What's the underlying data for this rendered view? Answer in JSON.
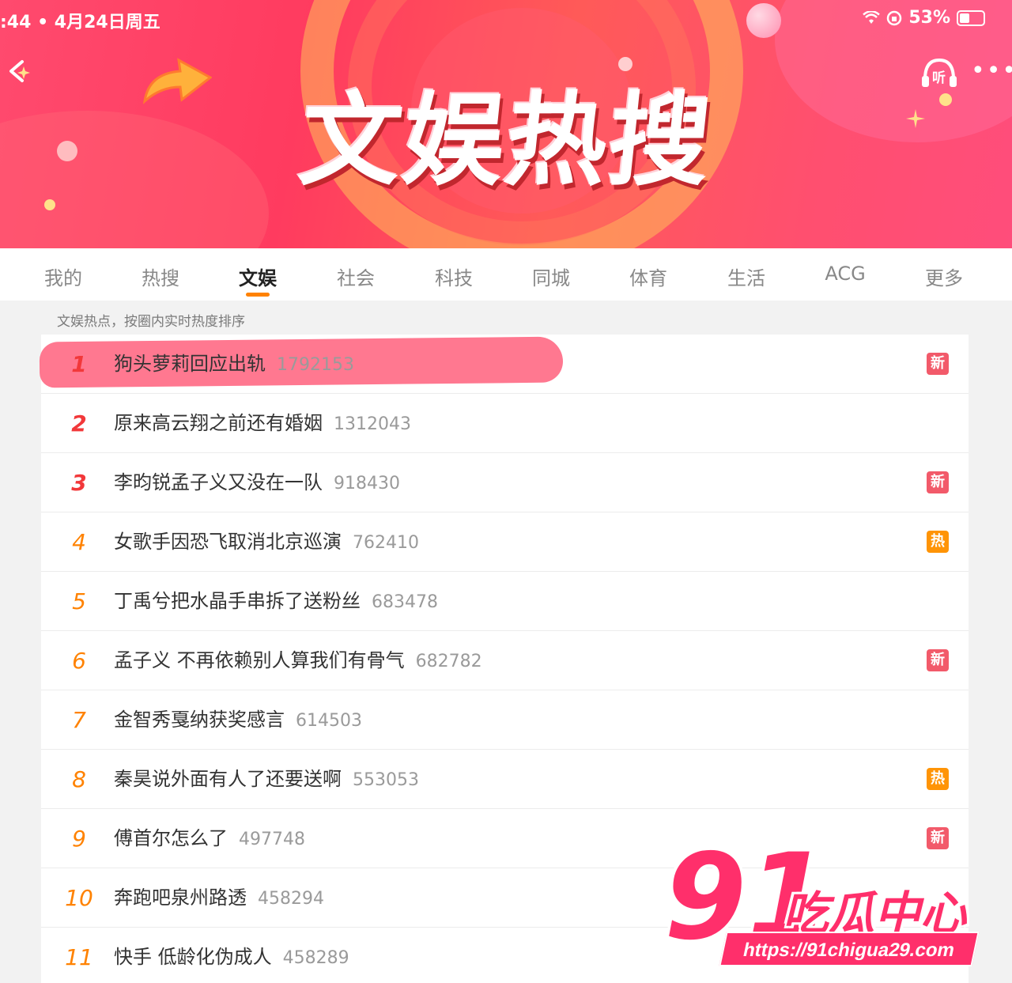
{
  "status_bar": {
    "time_date": ":44 • 4月24日周五",
    "battery": "53%"
  },
  "header": {
    "title": "文娱热搜",
    "listen_label": "听",
    "more_label": "•••"
  },
  "tabs": [
    {
      "label": "我的",
      "active": false
    },
    {
      "label": "热搜",
      "active": false
    },
    {
      "label": "文娱",
      "active": true
    },
    {
      "label": "社会",
      "active": false
    },
    {
      "label": "科技",
      "active": false
    },
    {
      "label": "同城",
      "active": false
    },
    {
      "label": "体育",
      "active": false
    },
    {
      "label": "生活",
      "active": false
    },
    {
      "label": "ACG",
      "active": false
    },
    {
      "label": "更多",
      "active": false
    }
  ],
  "subtitle": "文娱热点，按圈内实时热度排序",
  "list": [
    {
      "rank": "1",
      "title": "狗头萝莉回应出轨",
      "count": "1792153",
      "badge": "新",
      "badge_type": "new"
    },
    {
      "rank": "2",
      "title": "原来高云翔之前还有婚姻",
      "count": "1312043",
      "badge": "",
      "badge_type": ""
    },
    {
      "rank": "3",
      "title": "李昀锐孟子义又没在一队",
      "count": "918430",
      "badge": "新",
      "badge_type": "new"
    },
    {
      "rank": "4",
      "title": "女歌手因恐飞取消北京巡演",
      "count": "762410",
      "badge": "热",
      "badge_type": "hot"
    },
    {
      "rank": "5",
      "title": "丁禹兮把水晶手串拆了送粉丝",
      "count": "683478",
      "badge": "",
      "badge_type": ""
    },
    {
      "rank": "6",
      "title": "孟子义 不再依赖别人算我们有骨气",
      "count": "682782",
      "badge": "新",
      "badge_type": "new"
    },
    {
      "rank": "7",
      "title": "金智秀戛纳获奖感言",
      "count": "614503",
      "badge": "",
      "badge_type": ""
    },
    {
      "rank": "8",
      "title": "秦昊说外面有人了还要送啊",
      "count": "553053",
      "badge": "热",
      "badge_type": "hot"
    },
    {
      "rank": "9",
      "title": "傅首尔怎么了",
      "count": "497748",
      "badge": "新",
      "badge_type": "new"
    },
    {
      "rank": "10",
      "title": "奔跑吧泉州路透",
      "count": "458294",
      "badge": "",
      "badge_type": ""
    },
    {
      "rank": "11",
      "title": "快手 低龄化伪成人",
      "count": "458289",
      "badge": "",
      "badge_type": ""
    }
  ],
  "watermark": {
    "number": "91",
    "name": "吃瓜中心",
    "url": "https://91chigua29.com"
  },
  "colors": {
    "banner": "#ff4a6e",
    "tab_underline": "#ff8200",
    "rank_top": "#f2383a",
    "rank_other": "#ff8200",
    "badge_new": "#f25a6a",
    "badge_hot": "#ff9406",
    "highlight": "#ff5a78"
  }
}
